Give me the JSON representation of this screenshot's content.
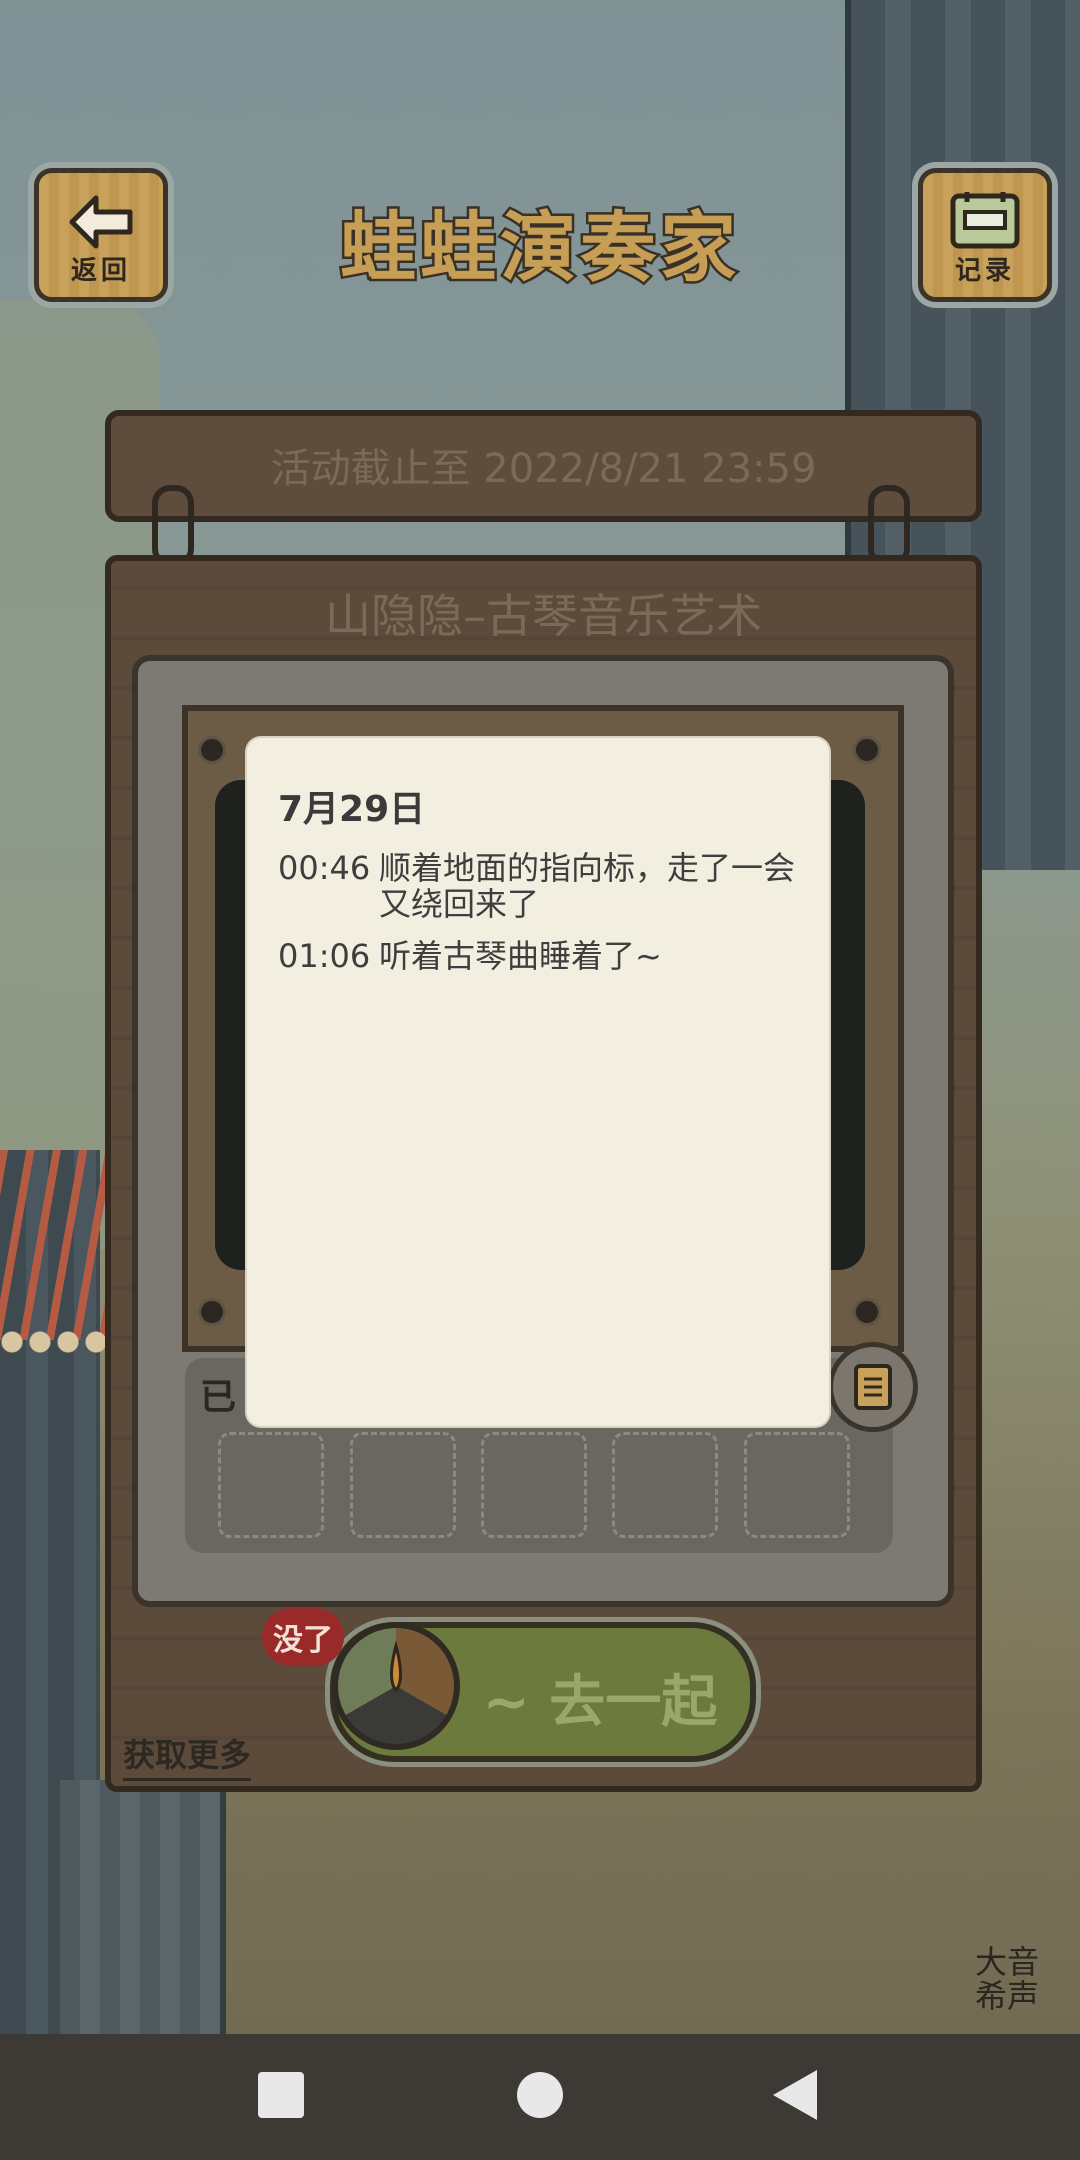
{
  "header": {
    "title": "蛙蛙演奏家",
    "back_label": "返回",
    "record_label": "记录"
  },
  "event_board": {
    "deadline_text": "活动截止至 2022/8/21 23:59",
    "title": "山隐隐–古琴音乐艺术"
  },
  "slots": {
    "label": "已",
    "count": 5
  },
  "controls": {
    "get_more": "获取更多",
    "go_label": "~ 去一起",
    "empty_badge": "没了"
  },
  "log_dialog": {
    "date": "7月29日",
    "entries": [
      {
        "time": "00:46",
        "text": "顺着地面的指向标，走了一会又绕回来了"
      },
      {
        "time": "01:06",
        "text": "听着古琴曲睡着了~"
      }
    ]
  },
  "watermark": "大音希声",
  "nav": {
    "recents": "recents-square-icon",
    "home": "home-circle-icon",
    "back": "back-triangle-icon"
  }
}
